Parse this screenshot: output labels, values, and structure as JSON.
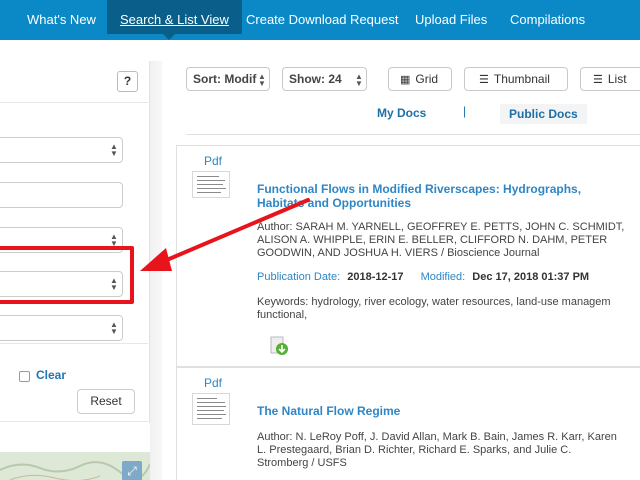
{
  "nav": {
    "tabs": [
      {
        "label": "What's New"
      },
      {
        "label": "Search & List View"
      },
      {
        "label": "Create Download Request"
      },
      {
        "label": "Upload Files"
      },
      {
        "label": "Compilations"
      }
    ]
  },
  "left_panel": {
    "help_label": "?",
    "clear_label": "Clear",
    "reset_label": "Reset",
    "expand_icon": "expand-icon"
  },
  "toolbar": {
    "sort_value": "Sort: Modif",
    "show_value": "Show: 24",
    "grid_label": "Grid",
    "thumbnail_label": "Thumbnail",
    "list_label": "List"
  },
  "doc_tabs": {
    "my_docs": "My Docs",
    "separator": "|",
    "public_docs": "Public Docs"
  },
  "results": [
    {
      "file_type": "Pdf",
      "title": "Functional Flows in Modified Riverscapes: Hydrographs, Habitats and Opportunities",
      "author_lines": [
        "Author: SARAH M. YARNELL, GEOFFREY E. PETTS, JOHN C. SCHMIDT,",
        "ALISON A. WHIPPLE, ERIN E. BELLER, CLIFFORD N. DAHM, PETER",
        "GOODWIN, AND JOSHUA H. VIERS / Bioscience Journal"
      ],
      "publication_date_label": "Publication Date:",
      "publication_date": "2018-12-17",
      "modified_label": "Modified:",
      "modified": "Dec 17, 2018 01:37 PM",
      "keywords_lines": [
        "Keywords: hydrology, river ecology, water resources, land-use managem",
        "functional,"
      ]
    },
    {
      "file_type": "Pdf",
      "title": "The Natural Flow Regime",
      "author_lines": [
        "Author: N. LeRoy Poff, J. David Allan, Mark B. Bain, James R. Karr, Karen",
        "L. Prestegaard, Brian D. Richter, Richard E. Sparks, and Julie C.",
        "Stromberg / USFS"
      ]
    }
  ],
  "colors": {
    "nav_bg": "#0b89c6",
    "nav_active": "#0a5f8a",
    "link_blue": "#2e86c5",
    "annotation_red": "#e8141c"
  }
}
